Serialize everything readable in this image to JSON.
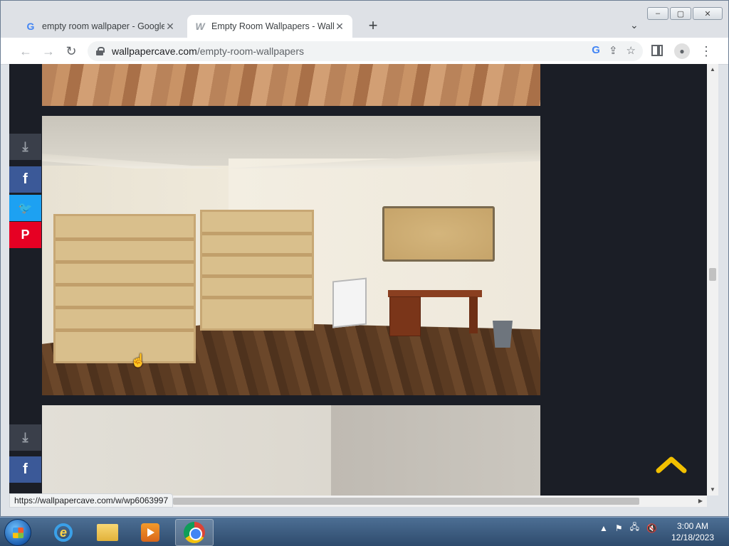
{
  "browser": {
    "tabs": [
      {
        "title": "empty room wallpaper - Google",
        "favicon": "google-icon",
        "active": false
      },
      {
        "title": "Empty Room Wallpapers - Wallpa",
        "favicon": "wallpapercave-icon",
        "active": true
      }
    ],
    "new_tab_label": "+",
    "window_controls": {
      "minimize": "‒",
      "maximize": "▢",
      "close": "✕"
    },
    "address": {
      "host": "wallpapercave.com",
      "path": "/empty-room-wallpapers"
    },
    "status_url": "https://wallpapercave.com/w/wp6063997"
  },
  "page": {
    "share_buttons": [
      {
        "kind": "download",
        "glyph": "⤓"
      },
      {
        "kind": "facebook",
        "glyph": "f"
      },
      {
        "kind": "twitter",
        "glyph": "🐦"
      },
      {
        "kind": "pinterest",
        "glyph": "P"
      }
    ],
    "second_share_buttons": [
      {
        "kind": "download",
        "glyph": "⤓"
      },
      {
        "kind": "facebook",
        "glyph": "f"
      }
    ],
    "scroll_top_color": "#f2c000"
  },
  "taskbar": {
    "clock_time": "3:00 AM",
    "clock_date": "12/18/2023",
    "tray_arrow": "▲"
  }
}
